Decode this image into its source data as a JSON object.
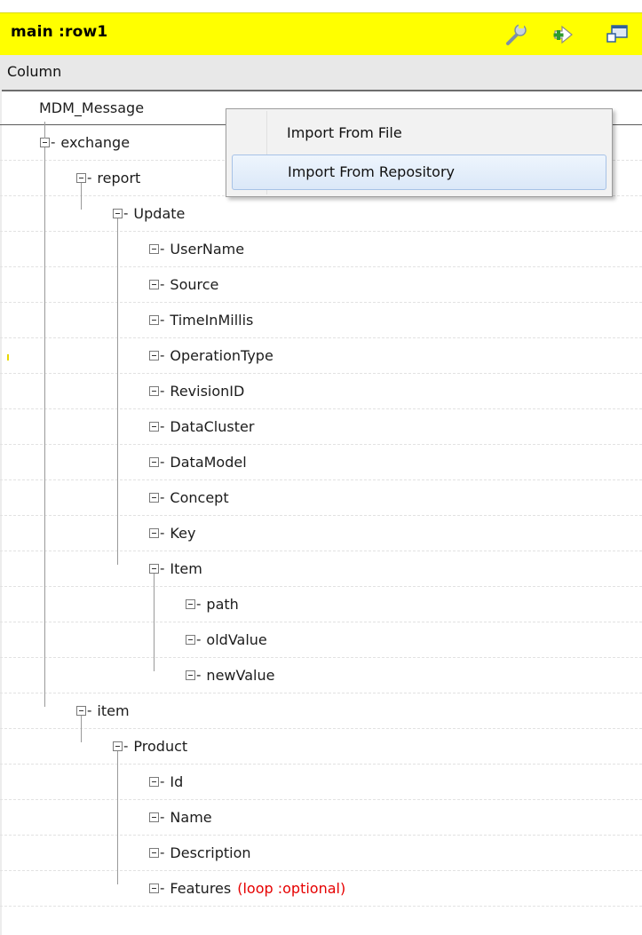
{
  "header": {
    "title": "main :row1",
    "icons": [
      "wrench-icon",
      "import-arrow-icon",
      "window-icon"
    ]
  },
  "column_header": {
    "label": "Column"
  },
  "tree": {
    "root": "MDM_Message",
    "nodes": [
      {
        "label": "exchange"
      },
      {
        "label": "report"
      },
      {
        "label": "Update"
      },
      {
        "label": "UserName"
      },
      {
        "label": "Source"
      },
      {
        "label": "TimeInMillis"
      },
      {
        "label": "OperationType"
      },
      {
        "label": "RevisionID"
      },
      {
        "label": "DataCluster"
      },
      {
        "label": "DataModel"
      },
      {
        "label": "Concept"
      },
      {
        "label": "Key"
      },
      {
        "label": "Item"
      },
      {
        "label": "path"
      },
      {
        "label": "oldValue"
      },
      {
        "label": "newValue"
      },
      {
        "label": "item"
      },
      {
        "label": "Product"
      },
      {
        "label": "Id"
      },
      {
        "label": "Name"
      },
      {
        "label": "Description"
      },
      {
        "label": "Features",
        "annotation": "(loop :optional)"
      }
    ]
  },
  "context_menu": {
    "items": [
      {
        "label": "Import From File"
      },
      {
        "label": "Import From Repository"
      }
    ]
  },
  "colors": {
    "title_bar": "#ffff00",
    "annotation": "#e60000",
    "menu_hover": "#dbe8f8"
  }
}
